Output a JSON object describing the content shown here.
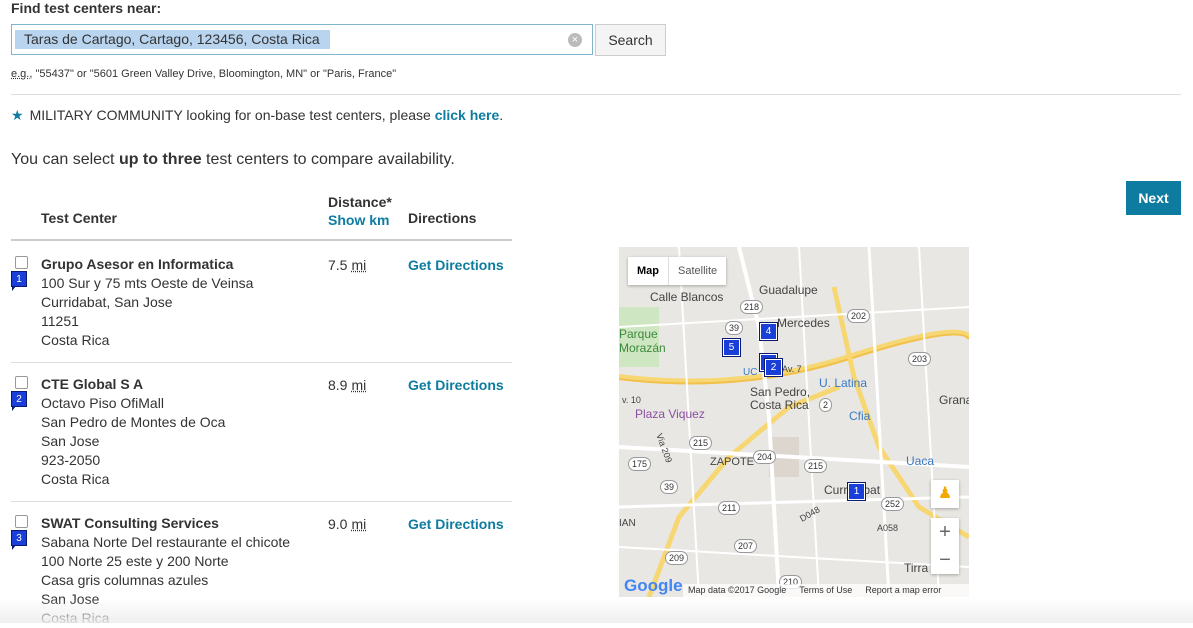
{
  "search": {
    "label": "Find test centers near:",
    "value": "Taras de Cartago, Cartago, 123456, Costa Rica",
    "button": "Search",
    "eg_prefix": "e.g.,",
    "eg_text": " \"55437\" or \"5601 Green Valley Drive, Bloomington, MN\" or \"Paris, France\""
  },
  "military": {
    "text": "MILITARY COMMUNITY looking for on-base test centers, please ",
    "link": "click here",
    "suffix": "."
  },
  "compare": {
    "prefix": "You can select ",
    "bold": "up to three",
    "suffix": " test centers to compare availability."
  },
  "next_button": "Next",
  "table": {
    "col_center": "Test Center",
    "col_distance": "Distance*",
    "show_km": "Show km",
    "col_directions": "Directions",
    "rows": [
      {
        "pin": "1",
        "name": "Grupo Asesor en Informatica",
        "lines": [
          "100 Sur y 75 mts Oeste de Veinsa",
          "Curridabat, San Jose",
          "11251",
          "Costa Rica"
        ],
        "distance": "7.5",
        "unit": "mi",
        "directions": "Get Directions"
      },
      {
        "pin": "2",
        "name": "CTE Global S A",
        "lines": [
          "Octavo Piso OfiMall",
          "San Pedro de Montes de Oca",
          "San Jose",
          "923-2050",
          "Costa Rica"
        ],
        "distance": "8.9",
        "unit": "mi",
        "directions": "Get Directions"
      },
      {
        "pin": "3",
        "name": "SWAT Consulting Services",
        "lines": [
          "Sabana Norte Del restaurante el chicote",
          "100 Norte 25 este y 200 Norte",
          "Casa gris columnas azules",
          "San Jose",
          "Costa Rica"
        ],
        "distance": "9.0",
        "unit": "mi",
        "directions": "Get Directions"
      }
    ]
  },
  "map": {
    "toggle_map": "Map",
    "toggle_satellite": "Satellite",
    "google": "Google",
    "data": "Map data ©2017 Google",
    "terms": "Terms of Use",
    "report": "Report a map error",
    "zoom_in": "+",
    "zoom_out": "−",
    "labels": {
      "calle_blancos": "Calle Blancos",
      "guadalupe": "Guadalupe",
      "mercedes": "Mercedes",
      "parque": "Parque",
      "morazan": "Morazán",
      "san_pedro": "San Pedro,",
      "costa_rica": "Costa Rica",
      "u_latina": "U. Latina",
      "cfia": "Cfia",
      "plaza_viquez": "Plaza Viquez",
      "zapote": "ZAPOTE",
      "uaca": "Uaca",
      "curridabat": "Curridabat",
      "grana": "Grana",
      "tirra": "Tirra",
      "ian": "IAN",
      "ucr": "UC",
      "av7": "Av. 7",
      "v10": "v. 10",
      "via209": "Via 209",
      "d048": "D048",
      "a058": "A058"
    },
    "shields": [
      "218",
      "202",
      "39",
      "203",
      "2",
      "215",
      "204",
      "215",
      "175",
      "39",
      "252",
      "211",
      "207",
      "209",
      "210"
    ],
    "pins": [
      "4",
      "5",
      "3",
      "2",
      "1"
    ]
  }
}
